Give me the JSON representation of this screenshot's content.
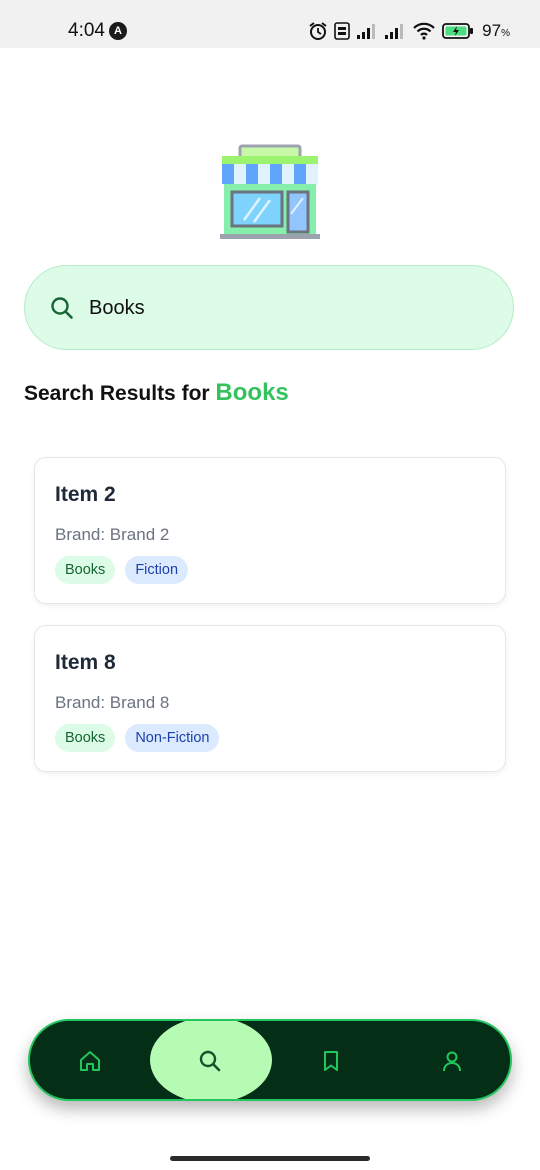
{
  "status_bar": {
    "time": "4:04",
    "app_badge": "A",
    "battery_percent": "97",
    "battery_unit": "%"
  },
  "search": {
    "value": "Books"
  },
  "results": {
    "heading_prefix": "Search Results for",
    "query": "Books",
    "items": [
      {
        "title": "Item 2",
        "brand": "Brand: Brand 2",
        "tags": [
          "Books",
          "Fiction"
        ]
      },
      {
        "title": "Item 8",
        "brand": "Brand: Brand 8",
        "tags": [
          "Books",
          "Non-Fiction"
        ]
      }
    ]
  },
  "nav": {
    "items": [
      "home-icon",
      "search-icon",
      "bookmark-icon",
      "user-icon"
    ],
    "active": "search-icon",
    "accent_color": "#22c55e",
    "background_color": "#052e16",
    "active_color": "#b6fbb3"
  },
  "colors": {
    "search_background": "#dcfce7",
    "query_highlight": "#34c25d",
    "tag_green": "#dcfce7",
    "tag_blue": "#dbeafe"
  }
}
